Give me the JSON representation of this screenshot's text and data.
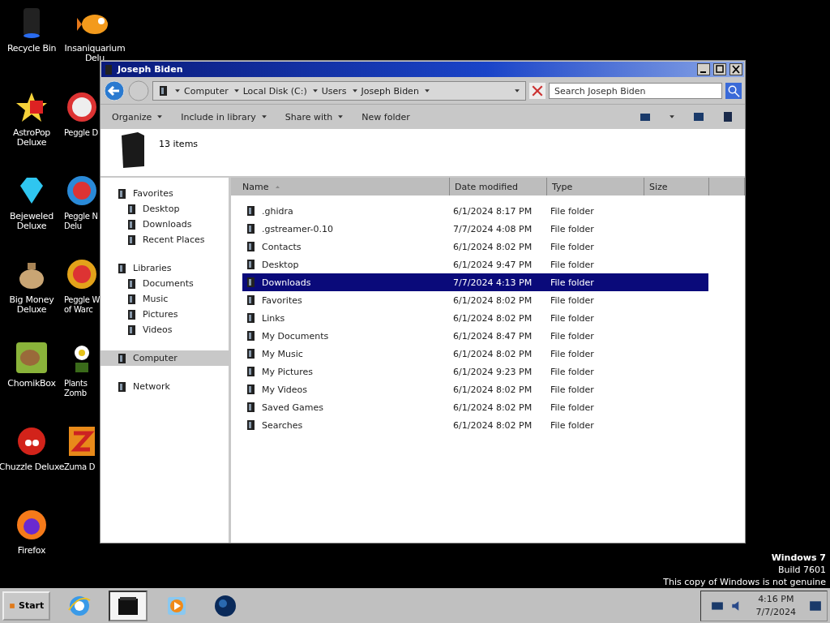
{
  "desktop_icons": [
    {
      "lines": [
        "Recycle Bin"
      ]
    },
    {
      "lines": [
        "Insaniquarium",
        "Delu"
      ]
    },
    {
      "lines": [
        "AstroPop",
        "Deluxe"
      ]
    },
    {
      "lines": [
        "Peggle D"
      ]
    },
    {
      "lines": [
        "Bejeweled",
        "Deluxe"
      ]
    },
    {
      "lines": [
        "Peggle N",
        "Delu"
      ]
    },
    {
      "lines": [
        "Big Money",
        "Deluxe"
      ]
    },
    {
      "lines": [
        "Peggle W",
        "of Warc"
      ]
    },
    {
      "lines": [
        "ChomikBox"
      ]
    },
    {
      "lines": [
        "Plants",
        "Zomb"
      ]
    },
    {
      "lines": [
        "Chuzzle Deluxe"
      ]
    },
    {
      "lines": [
        "Zuma D"
      ]
    },
    {
      "lines": [
        "Firefox"
      ]
    }
  ],
  "window": {
    "title": "Joseph Biden",
    "breadcrumb": [
      "Computer",
      "Local Disk (C:)",
      "Users",
      "Joseph Biden"
    ],
    "search": {
      "placeholder": "Search Joseph Biden"
    },
    "toolbar": [
      {
        "label": "Organize",
        "menu": true
      },
      {
        "label": "Include in library",
        "menu": true
      },
      {
        "label": "Share with",
        "menu": true
      },
      {
        "label": "New folder",
        "menu": false
      }
    ],
    "item_count": "13 items",
    "nav": [
      {
        "label": "Favorites",
        "selected": false,
        "children": [
          {
            "label": "Desktop",
            "selected": false
          },
          {
            "label": "Downloads",
            "selected": false
          },
          {
            "label": "Recent Places",
            "selected": false
          }
        ]
      },
      {
        "label": "Libraries",
        "selected": false,
        "children": [
          {
            "label": "Documents",
            "selected": false
          },
          {
            "label": "Music",
            "selected": false
          },
          {
            "label": "Pictures",
            "selected": false
          },
          {
            "label": "Videos",
            "selected": false
          }
        ]
      },
      {
        "label": "Computer",
        "selected": true
      },
      {
        "label": "Network",
        "selected": false
      }
    ],
    "columns": [
      "Name",
      "Date modified",
      "Type",
      "Size"
    ],
    "rows": [
      {
        "name": ".ghidra",
        "date": "6/1/2024 8:17 PM",
        "type": "File folder",
        "selected": false
      },
      {
        "name": ".gstreamer-0.10",
        "date": "7/7/2024 4:08 PM",
        "type": "File folder",
        "selected": false
      },
      {
        "name": "Contacts",
        "date": "6/1/2024 8:02 PM",
        "type": "File folder",
        "selected": false
      },
      {
        "name": "Desktop",
        "date": "6/1/2024 9:47 PM",
        "type": "File folder",
        "selected": false
      },
      {
        "name": "Downloads",
        "date": "7/7/2024 4:13 PM",
        "type": "File folder",
        "selected": true
      },
      {
        "name": "Favorites",
        "date": "6/1/2024 8:02 PM",
        "type": "File folder",
        "selected": false
      },
      {
        "name": "Links",
        "date": "6/1/2024 8:02 PM",
        "type": "File folder",
        "selected": false
      },
      {
        "name": "My Documents",
        "date": "6/1/2024 8:47 PM",
        "type": "File folder",
        "selected": false
      },
      {
        "name": "My Music",
        "date": "6/1/2024 8:02 PM",
        "type": "File folder",
        "selected": false
      },
      {
        "name": "My Pictures",
        "date": "6/1/2024 9:23 PM",
        "type": "File folder",
        "selected": false
      },
      {
        "name": "My Videos",
        "date": "6/1/2024 8:02 PM",
        "type": "File folder",
        "selected": false
      },
      {
        "name": "Saved Games",
        "date": "6/1/2024 8:02 PM",
        "type": "File folder",
        "selected": false
      },
      {
        "name": "Searches",
        "date": "6/1/2024 8:02 PM",
        "type": "File folder",
        "selected": false
      }
    ]
  },
  "watermark": {
    "title": "Windows 7",
    "build": "Build 7601",
    "notice": "This copy of Windows is not genuine"
  },
  "taskbar": {
    "start": "Start",
    "apps": [
      {
        "selected": false
      },
      {
        "selected": true
      },
      {
        "selected": false
      },
      {
        "selected": false
      }
    ],
    "time": "4:16 PM",
    "date": "7/7/2024"
  }
}
